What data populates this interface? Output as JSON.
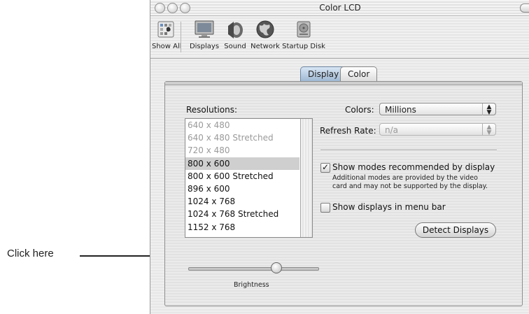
{
  "callout": {
    "text": "Click here"
  },
  "window": {
    "title": "Color LCD"
  },
  "toolbar": {
    "items": [
      {
        "label": "Show All",
        "icon": "show-all-icon"
      },
      {
        "label": "Displays",
        "icon": "monitor-icon"
      },
      {
        "label": "Sound",
        "icon": "speaker-icon"
      },
      {
        "label": "Network",
        "icon": "globe-icon"
      },
      {
        "label": "Startup Disk",
        "icon": "hard-disk-icon"
      }
    ]
  },
  "tabs": [
    {
      "label": "Display",
      "selected": true
    },
    {
      "label": "Color",
      "selected": false
    }
  ],
  "resolutions": {
    "label": "Resolutions:",
    "items": [
      {
        "text": "640 x 480",
        "state": "disabled"
      },
      {
        "text": "640 x 480 Stretched",
        "state": "disabled"
      },
      {
        "text": "720 x 480",
        "state": "disabled"
      },
      {
        "text": "800 x 600",
        "state": "selected"
      },
      {
        "text": "800 x 600 Stretched",
        "state": "normal"
      },
      {
        "text": "896 x 600",
        "state": "normal"
      },
      {
        "text": "1024 x 768",
        "state": "normal"
      },
      {
        "text": "1024 x 768 Stretched",
        "state": "normal"
      },
      {
        "text": "1152 x 768",
        "state": "normal"
      }
    ]
  },
  "colors": {
    "label": "Colors:",
    "value": "Millions"
  },
  "refresh_rate": {
    "label": "Refresh Rate:",
    "value": "n/a"
  },
  "show_modes": {
    "label": "Show modes recommended by display",
    "checked": true,
    "note_line1": "Additional modes are provided by the video",
    "note_line2": "card and may not be supported by the display."
  },
  "show_menu_bar": {
    "label": "Show displays in menu bar",
    "checked": false
  },
  "detect_button": {
    "label": "Detect Displays"
  },
  "brightness": {
    "label": "Brightness",
    "level_fraction": 0.64
  }
}
